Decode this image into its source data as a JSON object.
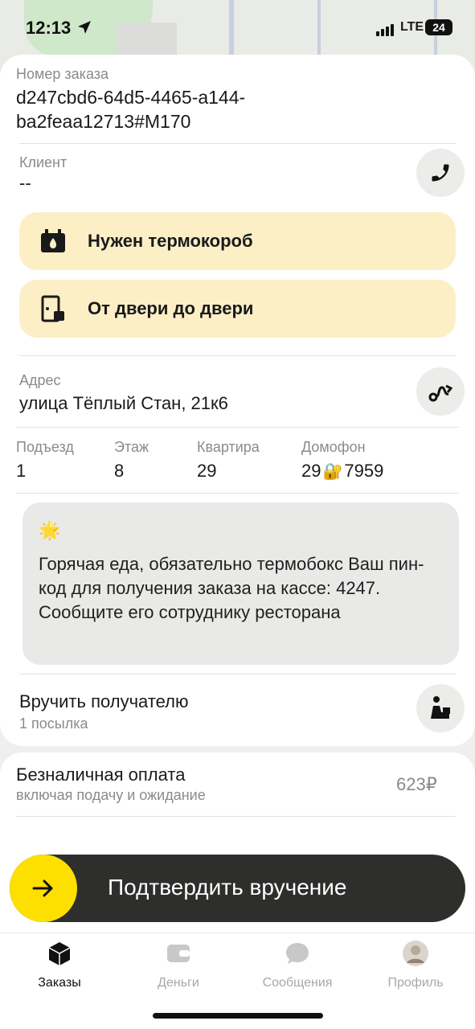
{
  "status_bar": {
    "time": "12:13",
    "network": "LTE",
    "battery": "24"
  },
  "order": {
    "label": "Номер заказа",
    "value_line1": "d247cbd6-64d5-4465-a144-",
    "value_line2": "ba2feaa12713#M170"
  },
  "client": {
    "label": "Клиент",
    "value": "--"
  },
  "tags": [
    {
      "label": "Нужен термокороб",
      "icon": "thermo-box-icon"
    },
    {
      "label": "От двери до двери",
      "icon": "door-to-door-icon"
    }
  ],
  "address": {
    "label": "Адрес",
    "value": "улица Тёплый Стан, 21к6"
  },
  "details": [
    {
      "label": "Подъезд",
      "value": "1"
    },
    {
      "label": "Этаж",
      "value": "8"
    },
    {
      "label": "Квартира",
      "value": "29"
    },
    {
      "label": "Домофон",
      "value_before": "29",
      "value_after": "7959",
      "icon": "lock-key-emoji-icon"
    }
  ],
  "comment": {
    "icon": "star-emoji-icon",
    "text": "Горячая еда, обязательно термобокс Ваш пин-код для получения заказа на кассе: 4247. Сообщите его сотруднику ресторана"
  },
  "handover": {
    "title": "Вручить получателю",
    "subtitle": "1 посылка"
  },
  "payment": {
    "title": "Безналичная оплата",
    "subtitle": "включая подачу и ожидание",
    "amount": "623₽"
  },
  "confirm": {
    "label": "Подтвердить вручение"
  },
  "tabs": [
    {
      "label": "Заказы",
      "icon": "orders-box-icon",
      "active": true
    },
    {
      "label": "Деньги",
      "icon": "wallet-icon",
      "active": false
    },
    {
      "label": "Сообщения",
      "icon": "chat-bubble-icon",
      "active": false
    },
    {
      "label": "Профиль",
      "icon": "avatar-icon",
      "active": false
    }
  ],
  "colors": {
    "accent_yellow": "#fde000",
    "tag_bg": "#fcefc6",
    "slider_bg": "#2e2e2c",
    "muted": "#8a8a8a"
  }
}
